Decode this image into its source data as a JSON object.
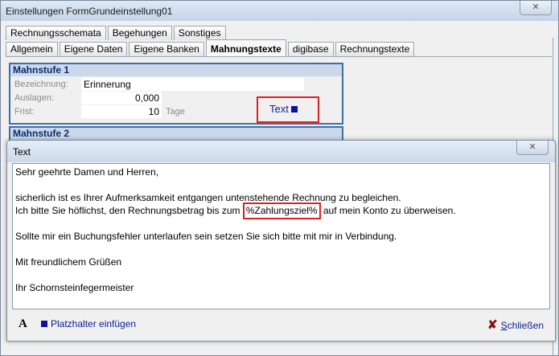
{
  "window": {
    "title": "Einstellungen FormGrundeinstellung01",
    "close_symbol": "✕"
  },
  "tabs_row1": [
    "Rechnungsschemata",
    "Begehungen",
    "Sonstiges"
  ],
  "tabs_row2": [
    "Allgemein",
    "Eigene Daten",
    "Eigene Banken",
    "Mahnungstexte",
    "digibase",
    "Rechnungstexte"
  ],
  "active_tab": "Mahnungstexte",
  "stage1": {
    "heading": "Mahnstufe 1",
    "label_name": "Bezeichnung:",
    "name_value": "Erinnerung",
    "label_costs": "Auslagen:",
    "costs_value": "0,000",
    "label_term": "Frist:",
    "term_value": "10",
    "term_unit": "Tage",
    "text_button": "Text"
  },
  "stage2": {
    "heading": "Mahnstufe 2"
  },
  "dialog": {
    "title": "Text",
    "close_symbol": "✕",
    "lines": {
      "l1": "Sehr geehrte Damen und Herren,",
      "l3": "sicherlich ist es Ihrer Aufmerksamkeit entgangen untenstehende Rechnung zu begleichen.",
      "l4_before": "Ich bitte Sie höflichst, den Rechnungsbetrag bis zum ",
      "l4_placeholder": "%Zahlungsziel%",
      "l4_after": " auf mein Konto zu überweisen.",
      "l6": "Sollte mir ein Buchungsfehler unterlaufen sein setzen Sie sich bitte mit mir in Verbindung.",
      "l8": "Mit freundlichem Grüßen",
      "l10": "Ihr Schornsteinfegermeister"
    },
    "font_button": "A",
    "insert_placeholder": "Platzhalter einfügen",
    "close_label_first": "S",
    "close_label_rest": "chließen"
  },
  "colors": {
    "accent": "#3d6ea8",
    "highlight": "#e02020",
    "link": "#0b1f8f"
  }
}
